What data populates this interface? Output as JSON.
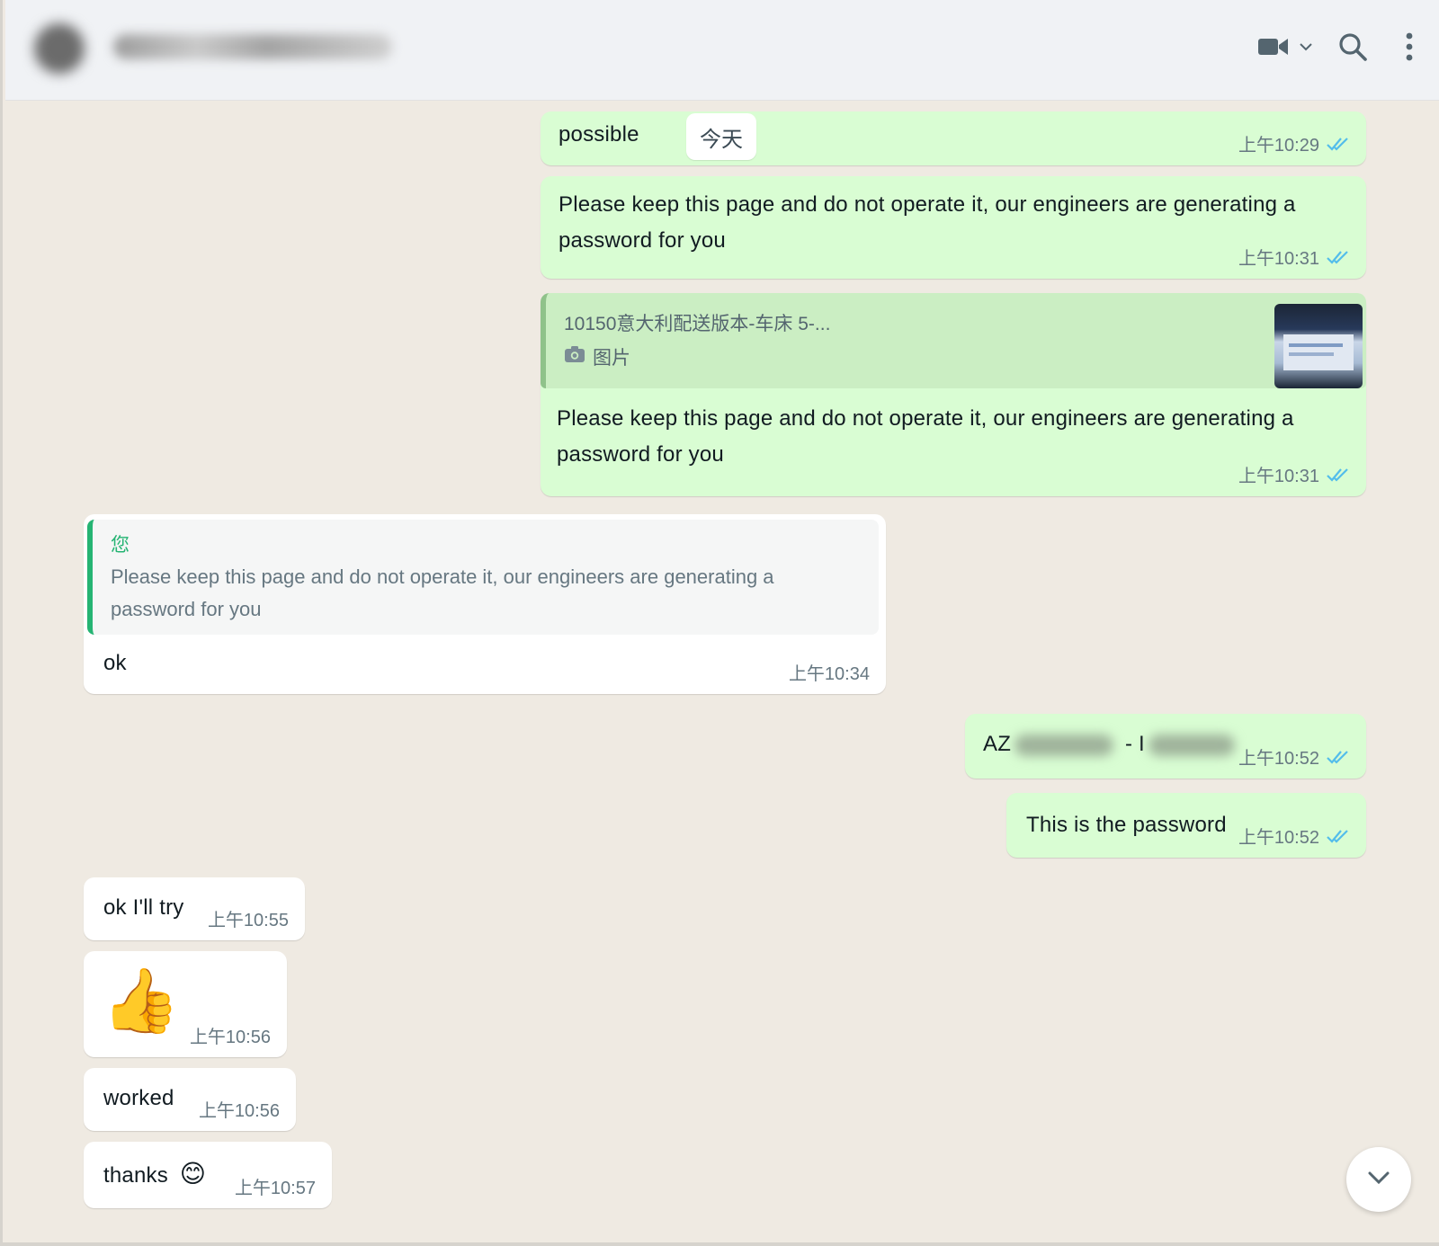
{
  "header": {
    "contact_name": "███████ ████ ███",
    "icons": [
      "video-call-icon",
      "chevron-down-icon",
      "search-icon",
      "more-vertical-icon"
    ]
  },
  "date_chip": "今天",
  "messages": [
    {
      "text": "possible",
      "time": "上午10:29",
      "direction": "out",
      "status": "read"
    },
    {
      "text": "Please keep this page and do not operate it, our engineers are generating a password for you",
      "time": "上午10:31",
      "direction": "out",
      "status": "read"
    },
    {
      "quote_title": "10150意大利配送版本-车床 5-...",
      "quote_type": "图片",
      "text": "Please keep this page and do not operate it, our engineers are generating a password for you",
      "time": "上午10:31",
      "direction": "out",
      "status": "read"
    },
    {
      "quote_author": "您",
      "quote_text": "Please keep this page and do not operate it, our engineers are generating a password for you",
      "text": "ok",
      "time": "上午10:34",
      "direction": "in"
    },
    {
      "text_prefix": "AZ",
      "text_mid": "-",
      "text_mid2": "I",
      "time": "上午10:52",
      "direction": "out",
      "status": "read"
    },
    {
      "text": "This is the password",
      "time": "上午10:52",
      "direction": "out",
      "status": "read"
    },
    {
      "text": "ok I'll try",
      "time": "上午10:55",
      "direction": "in"
    },
    {
      "emoji": "👍",
      "time": "上午10:56",
      "direction": "in"
    },
    {
      "text": "worked",
      "time": "上午10:56",
      "direction": "in"
    },
    {
      "text": "thanks",
      "emoji": "😊",
      "time": "上午10:57",
      "direction": "in"
    }
  ],
  "colors": {
    "chat_background": "#efeae2",
    "outgoing_bubble": "#d9fdd3",
    "incoming_bubble": "#ffffff",
    "read_ticks": "#53bdeb",
    "quote_accent": "#25b473"
  }
}
